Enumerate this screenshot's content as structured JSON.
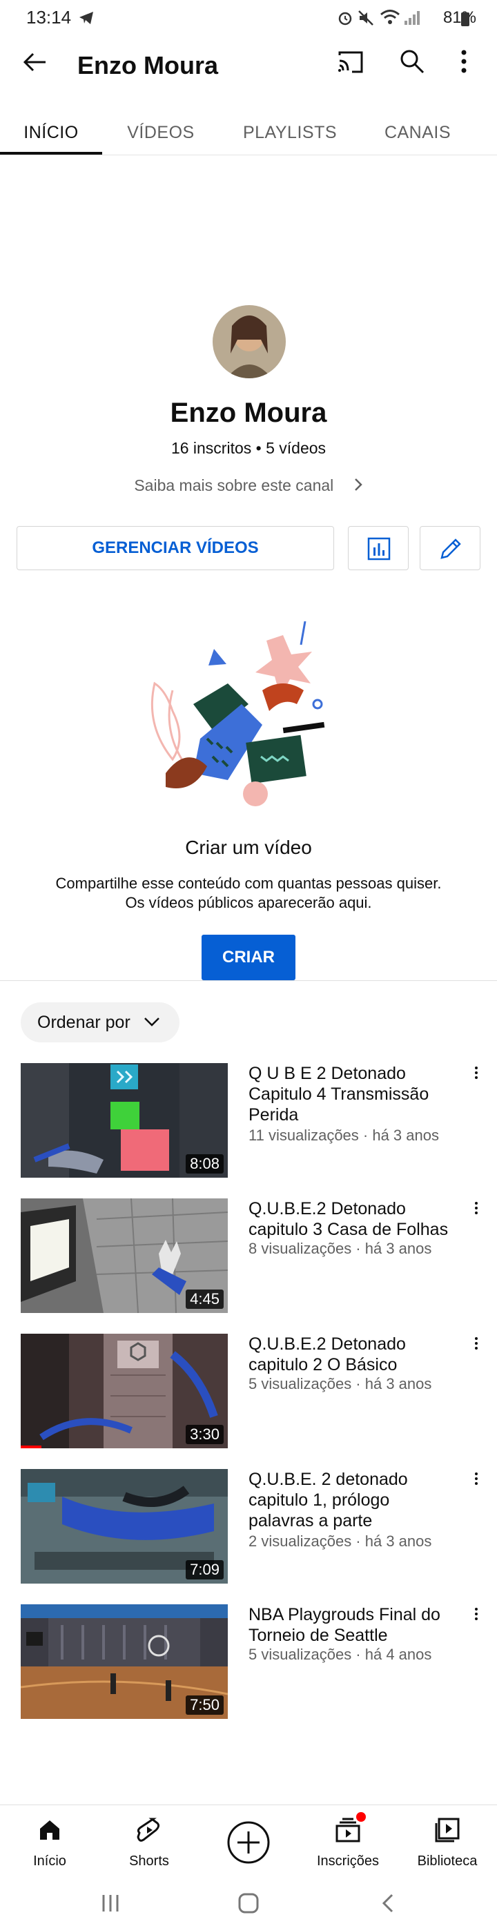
{
  "status_bar": {
    "time": "13:14",
    "battery": "81%"
  },
  "app_bar": {
    "title": "Enzo Moura"
  },
  "tabs": [
    {
      "label": "INÍCIO",
      "active": true
    },
    {
      "label": "VÍDEOS",
      "active": false
    },
    {
      "label": "PLAYLISTS",
      "active": false
    },
    {
      "label": "CANAIS",
      "active": false
    }
  ],
  "channel": {
    "name": "Enzo Moura",
    "stats": "16 inscritos • 5 vídeos",
    "about_link": "Saiba mais sobre este canal"
  },
  "actions": {
    "manage_videos": "GERENCIAR VÍDEOS",
    "analytics_icon": "analytics-icon",
    "edit_icon": "pencil-icon"
  },
  "empty_state": {
    "title": "Criar um vídeo",
    "line1": "Compartilhe esse conteúdo com quantas pessoas quiser.",
    "line2": "Os vídeos públicos aparecerão aqui.",
    "button": "CRIAR"
  },
  "sort": {
    "label": "Ordenar por"
  },
  "videos": [
    {
      "title": "Q U B E 2 Detonado Capitulo 4 Transmissão Perida",
      "meta": "11 visualizações · há 3 anos",
      "duration": "8:08",
      "progress": 0
    },
    {
      "title": "Q.U.B.E.2 Detonado capitulo 3 Casa de Folhas",
      "meta": "8 visualizações · há 3 anos",
      "duration": "4:45",
      "progress": 0
    },
    {
      "title": "Q.U.B.E.2 Detonado capitulo 2 O Básico",
      "meta": "5 visualizações · há 3 anos",
      "duration": "3:30",
      "progress": 0.1
    },
    {
      "title": "Q.U.B.E. 2 detonado capitulo 1, prólogo palavras a parte",
      "meta": "2 visualizações · há 3 anos",
      "duration": "7:09",
      "progress": 0
    },
    {
      "title": "NBA Playgrouds Final do Torneio de Seattle",
      "meta": "5 visualizações · há 4 anos",
      "duration": "7:50",
      "progress": 0
    }
  ],
  "bottom_nav": [
    {
      "label": "Início",
      "icon": "home-icon"
    },
    {
      "label": "Shorts",
      "icon": "shorts-icon"
    },
    {
      "label": "",
      "icon": "create-icon"
    },
    {
      "label": "Inscrições",
      "icon": "subscriptions-icon"
    },
    {
      "label": "Biblioteca",
      "icon": "library-icon"
    }
  ],
  "colors": {
    "accent": "#065fd4",
    "text": "#0f0f0f",
    "secondary": "#606060",
    "notification": "#ff0000"
  }
}
